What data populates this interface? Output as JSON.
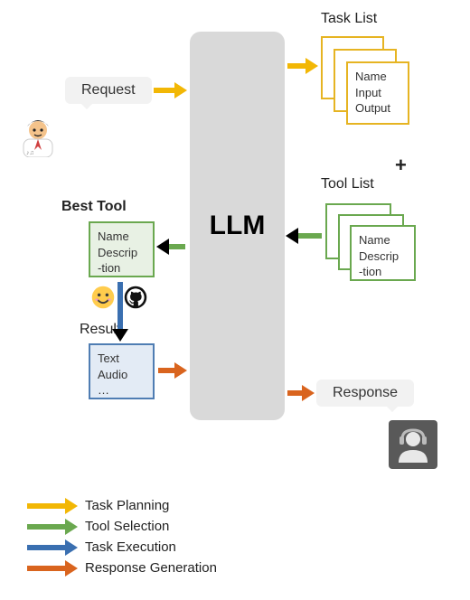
{
  "center": {
    "llm": "LLM"
  },
  "bubbles": {
    "request": "Request",
    "response": "Response"
  },
  "labels": {
    "task_list": "Task List",
    "tool_list": "Tool List",
    "plus": "+",
    "best_tool": "Best Tool",
    "result": "Result"
  },
  "task_card": {
    "line1": "Name",
    "line2": "Input",
    "line3": "Output"
  },
  "tool_card": {
    "line1": "Name",
    "line2": "Descrip",
    "line3": "-tion"
  },
  "best_card": {
    "line1": "Name",
    "line2": "Descrip",
    "line3": "-tion"
  },
  "result_card": {
    "line1": "Text",
    "line2": "Audio",
    "line3": "…"
  },
  "icons": {
    "huggingface": "huggingface-icon",
    "github": "github-icon"
  },
  "legend": {
    "task_planning": "Task Planning",
    "tool_selection": "Tool Selection",
    "task_execution": "Task Execution",
    "response_generation": "Response Generation"
  },
  "colors": {
    "yellow": "#f2b705",
    "green": "#6aa84f",
    "blue": "#3a6fb0",
    "orange": "#d9641e",
    "llm_bg": "#d9d9d9"
  }
}
